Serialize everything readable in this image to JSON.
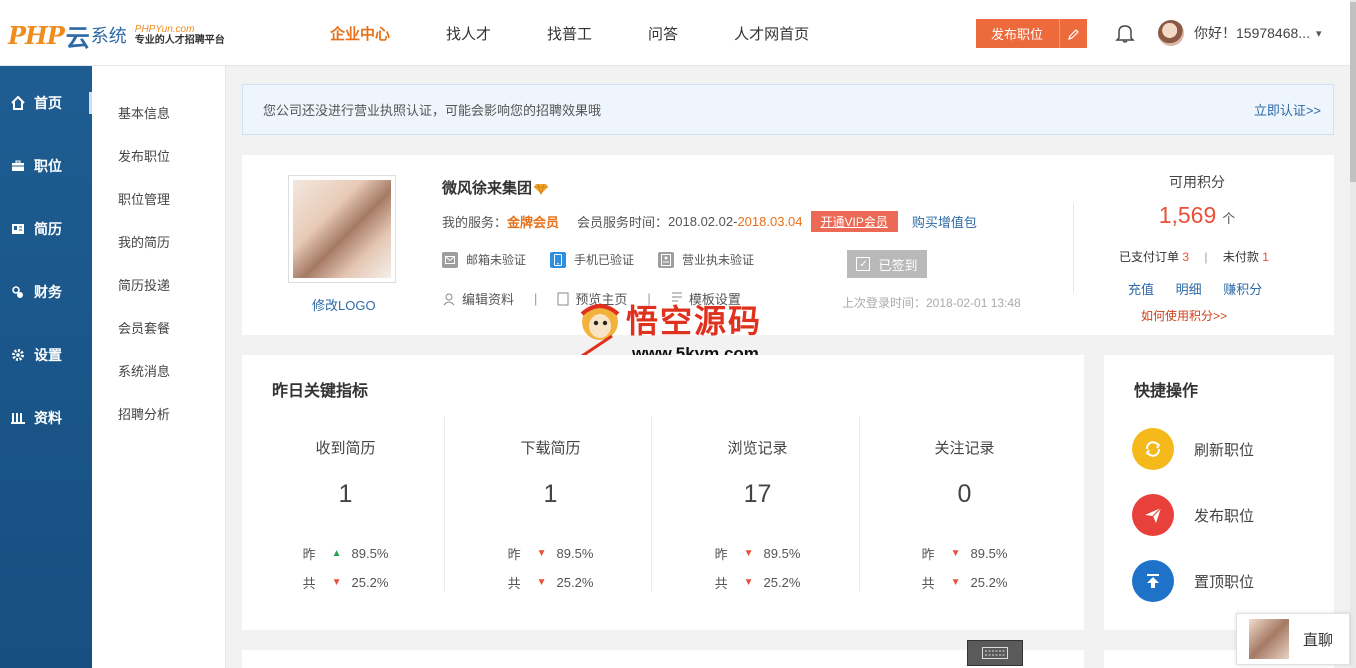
{
  "header": {
    "logo_php": "PHP",
    "logo_yun": "云",
    "logo_xt": "系统",
    "logo_site": "PHPYun.com",
    "logo_slogan": "专业的人才招聘平台",
    "nav": [
      "企业中心",
      "找人才",
      "找普工",
      "问答",
      "人才网首页"
    ],
    "nav_active": 0,
    "publish_label": "发布职位",
    "user_greeting": "你好！15978468..."
  },
  "sidebar": {
    "items": [
      {
        "label": "首页",
        "icon": "home-icon"
      },
      {
        "label": "职位",
        "icon": "briefcase-icon"
      },
      {
        "label": "简历",
        "icon": "id-card-icon"
      },
      {
        "label": "财务",
        "icon": "money-icon"
      },
      {
        "label": "设置",
        "icon": "gear-icon"
      },
      {
        "label": "资料",
        "icon": "books-icon"
      }
    ],
    "active": 0
  },
  "subnav": [
    "基本信息",
    "发布职位",
    "职位管理",
    "我的简历",
    "简历投递",
    "会员套餐",
    "系统消息",
    "招聘分析"
  ],
  "notice": {
    "message": "您公司还没进行营业执照认证，可能会影响您的招聘效果哦",
    "action": "立即认证>>"
  },
  "profile": {
    "change_logo": "修改LOGO",
    "company_name": "微风徐来集团",
    "service_label": "我的服务：",
    "service_value": "金牌会员",
    "time_label": "会员服务时间：",
    "time_start": "2018.02.02-",
    "time_end": "2018.03.04",
    "vip_button": "开通VIP会员",
    "buy_label": "购买增值包",
    "verify": [
      {
        "label": "邮箱未验证",
        "icon": "mail-icon",
        "color": "#9e9e9e"
      },
      {
        "label": "手机已验证",
        "icon": "phone-icon",
        "color": "#2d8fe0"
      },
      {
        "label": "营业执未验证",
        "icon": "license-icon",
        "color": "#9e9e9e"
      }
    ],
    "sign_label": "已签到",
    "links": [
      "编辑资料",
      "预览主页",
      "模板设置"
    ],
    "last_login": "上次登录时间：2018-02-01 13:48",
    "points_title": "可用积分",
    "points_value": "1,569",
    "points_unit": "个",
    "paid_label": "已支付订单",
    "paid_count": "3",
    "unpaid_label": "未付款",
    "unpaid_count": "1",
    "point_links": [
      "充值",
      "明细",
      "赚积分"
    ],
    "howto": "如何使用积分>>"
  },
  "watermark": {
    "title": "悟空源码",
    "url": "www.5kym.com"
  },
  "metrics": {
    "title": "昨日关键指标",
    "yesterday_label": "昨",
    "total_label": "共",
    "items": [
      {
        "title": "收到简历",
        "value": "1",
        "yesterday": "89.5%",
        "yesterday_dir": "up",
        "total": "25.2%",
        "total_dir": "down"
      },
      {
        "title": "下载简历",
        "value": "1",
        "yesterday": "89.5%",
        "yesterday_dir": "down",
        "total": "25.2%",
        "total_dir": "down"
      },
      {
        "title": "浏览记录",
        "value": "17",
        "yesterday": "89.5%",
        "yesterday_dir": "down",
        "total": "25.2%",
        "total_dir": "down"
      },
      {
        "title": "关注记录",
        "value": "0",
        "yesterday": "89.5%",
        "yesterday_dir": "down",
        "total": "25.2%",
        "total_dir": "down"
      }
    ]
  },
  "quick": {
    "title": "快捷操作",
    "items": [
      {
        "label": "刷新职位",
        "icon": "refresh-icon",
        "color": "#f5b91c"
      },
      {
        "label": "发布职位",
        "icon": "send-icon",
        "color": "#e8403a"
      },
      {
        "label": "置顶职位",
        "icon": "pin-top-icon",
        "color": "#1e73c8"
      }
    ]
  },
  "chat": {
    "label": "直聊"
  }
}
